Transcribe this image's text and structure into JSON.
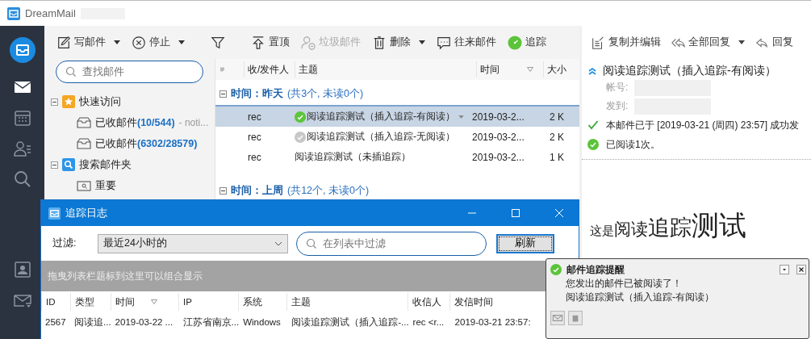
{
  "window": {
    "title": "DreamMail"
  },
  "rail_items": [
    {
      "kind": "mail",
      "selected": true
    },
    {
      "kind": "calendar",
      "selected": false
    },
    {
      "kind": "contacts",
      "selected": false
    },
    {
      "kind": "search",
      "selected": false
    },
    {
      "kind": "card",
      "selected": false
    },
    {
      "kind": "inbox",
      "selected": false
    }
  ],
  "toolbar": [
    {
      "kind": "compose",
      "label": "写邮件",
      "dropdown": true,
      "disabled": false
    },
    {
      "kind": "stop",
      "label": "停止",
      "dropdown": true,
      "disabled": false
    },
    {
      "kind": "filter",
      "dropdown": false,
      "disabled": false
    },
    {
      "kind": "pin",
      "label": "置顶",
      "dropdown": false,
      "disabled": false
    },
    {
      "kind": "spam",
      "label": "垃圾邮件",
      "dropdown": false,
      "disabled": true
    },
    {
      "kind": "delete",
      "label": "删除",
      "dropdown": true,
      "disabled": false
    },
    {
      "kind": "thread",
      "label": "往来邮件",
      "dropdown": false,
      "disabled": false
    },
    {
      "kind": "track",
      "label": "追踪",
      "dropdown": false,
      "disabled": false
    }
  ],
  "search": {
    "placeholder": "查找邮件"
  },
  "tree": [
    {
      "kind": "star",
      "label": "快速访问",
      "expanded": true,
      "children": [
        {
          "kind": "inbox",
          "label": "已收邮件",
          "count": "(10/544)",
          "note": "- noti..."
        },
        {
          "kind": "inbox",
          "label": "已收邮件",
          "count": "(6302/28579)"
        }
      ]
    },
    {
      "kind": "search",
      "label": "搜索邮件夹",
      "expanded": true,
      "children": [
        {
          "kind": "search-folder",
          "label": "重要"
        }
      ]
    }
  ],
  "mail_list": {
    "columns": [
      "收/发件人",
      "主题",
      "时间",
      "大小"
    ],
    "groups": [
      {
        "label": "时间：昨天",
        "summary": "(共3个, 未读0个)",
        "expanded": true,
        "rows": [
          {
            "sender": "rec",
            "subject": "阅读追踪测试（插入追踪-有阅读）",
            "time": "2019-03-2...",
            "size": "2 K",
            "selected": true,
            "tracked": true,
            "read": true
          },
          {
            "sender": "rec",
            "subject": "阅读追踪测试（插入追踪-无阅读）",
            "time": "2019-03-2...",
            "size": "2 K",
            "selected": false,
            "tracked": true,
            "read": false
          },
          {
            "sender": "rec",
            "subject": "阅读追踪测试（未插追踪）",
            "time": "2019-03-2...",
            "size": "1 K",
            "selected": false,
            "tracked": false
          }
        ]
      },
      {
        "label": "时间：上周",
        "summary": "(共12个, 未读0个)",
        "expanded": true
      }
    ]
  },
  "reader": {
    "toolbar": [
      {
        "kind": "copy-edit",
        "label": "复制并编辑",
        "dropdown": false
      },
      {
        "kind": "reply-all",
        "label": "全部回复",
        "dropdown": true
      },
      {
        "kind": "reply",
        "label": "回复",
        "dropdown": false
      }
    ],
    "subject": "阅读追踪测试（插入追踪-有阅读）",
    "fields": [
      {
        "label": "帐号:"
      },
      {
        "label": "发到:"
      }
    ],
    "status": [
      {
        "kind": "sent",
        "text": "本邮件已于 [2019-03-21 (周四) 23:57] 成功发"
      },
      {
        "kind": "read",
        "text": "已阅读1次。"
      }
    ],
    "body": [
      {
        "text": "这是",
        "kind": "small"
      },
      {
        "text": "阅读",
        "kind": "medium"
      },
      {
        "text": "追踪",
        "kind": "large"
      },
      {
        "text": "测试",
        "kind": "xlarge"
      }
    ]
  },
  "dialog": {
    "title": "追踪日志",
    "filter_label": "过滤:",
    "filter_value": "最近24小时的",
    "search_placeholder": "在列表中过滤",
    "refresh": "刷新",
    "group_hint": "拖曳列表栏题标到这里可以组合显示",
    "columns": [
      "ID",
      "类型",
      "时间",
      "IP",
      "系统",
      "主题",
      "收信人",
      "发信时间"
    ],
    "rows": [
      [
        "2567",
        "阅读追...",
        "2019-03-22 ...",
        "江苏省南京...",
        "Windows",
        "阅读追踪测试（插入追踪-...",
        "rec <r...",
        "2019-03-21 23:57:"
      ]
    ]
  },
  "notification": {
    "title": "邮件追踪提醒",
    "lines": [
      "您发出的邮件已被阅读了！",
      "阅读追踪测试（插入追踪-有阅读）"
    ]
  }
}
